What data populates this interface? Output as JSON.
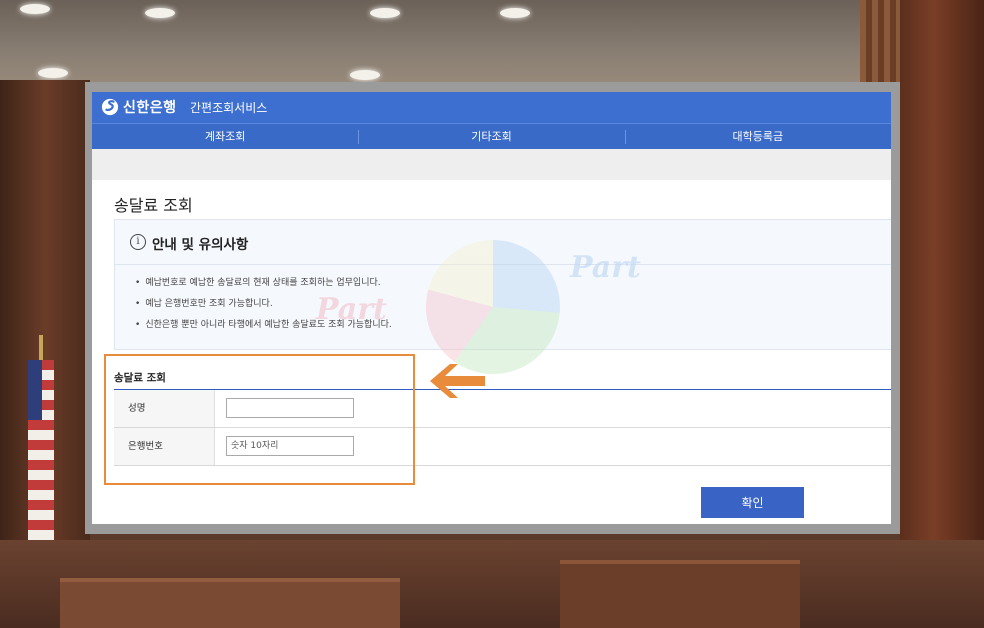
{
  "header": {
    "brand": "신한은행",
    "service": "간편조회서비스"
  },
  "nav": {
    "items": [
      "계좌조회",
      "기타조회",
      "대학등록금"
    ]
  },
  "page": {
    "title": "송달료 조회"
  },
  "notice": {
    "title": "안내 및 유의사항",
    "items": [
      "예납번호로 예납한 송달료의 현재 상태를 조회하는 업무입니다.",
      "예납 은행번호만 조회 가능합니다.",
      "신한은행 뿐만 아니라 타행에서 예납한 송달료도 조회 가능합니다."
    ]
  },
  "form": {
    "section_title": "송달료 조회",
    "name_label": "성명",
    "name_value": "",
    "bank_number_label": "은행번호",
    "bank_number_placeholder": "숫자 10자리"
  },
  "actions": {
    "confirm_label": "확인"
  },
  "watermark": {
    "text": "Part"
  },
  "colors": {
    "brand_blue": "#3d6fd0",
    "button_blue": "#3a63c6",
    "highlight_orange": "#e88b3a"
  }
}
